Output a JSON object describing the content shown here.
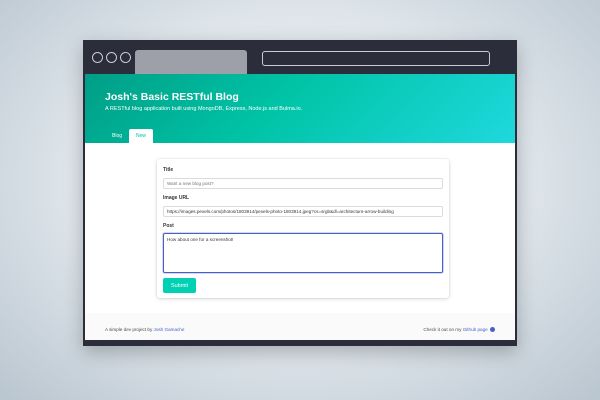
{
  "hero": {
    "title": "Josh's Basic RESTful Blog",
    "subtitle": "A RESTful blog application built using MongoDB, Express, Node.js and Bulma.io."
  },
  "tabs": [
    {
      "label": "Blog",
      "active": false
    },
    {
      "label": "New",
      "active": true
    }
  ],
  "form": {
    "title_label": "Title",
    "title_placeholder": "Want a new blog post?",
    "image_label": "Image URL",
    "image_value": "https://images.pexels.com/photos/1803914/pexels-photo-1803914.jpeg?cs=srgb&dl=architecture-arrow-building",
    "post_label": "Post",
    "post_value": "How about one for a screenshot!",
    "submit_label": "Submit"
  },
  "footer": {
    "left_text": "A simple dev project by ",
    "left_link": "Josh Gamache",
    "right_text": "Check it out on my ",
    "right_link": "Github page",
    "github_icon": "github-icon"
  },
  "colors": {
    "primary": "#00d1b2",
    "link": "#485fc7",
    "chrome": "#2b2d3a"
  }
}
